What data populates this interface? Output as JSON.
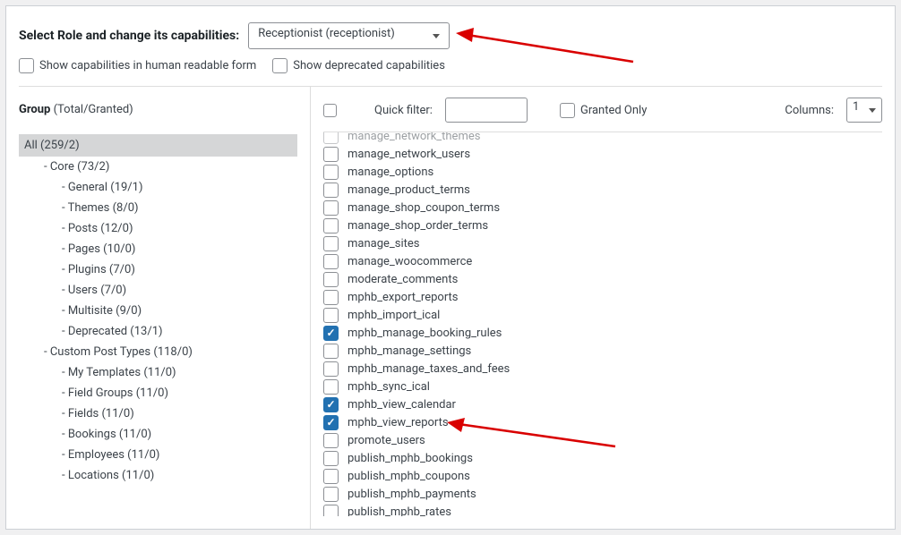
{
  "header": {
    "label": "Select Role and change its capabilities:",
    "selected_role": "Receptionist (receptionist)"
  },
  "options": {
    "human_readable_label": "Show capabilities in human readable form",
    "deprecated_label": "Show deprecated capabilities"
  },
  "sidebar": {
    "title_strong": "Group",
    "title_counts": "(Total/Granted)",
    "all_label": "All (259/2)",
    "tree": [
      {
        "lvl": 1,
        "label": "- Core (73/2)"
      },
      {
        "lvl": 2,
        "label": "- General (19/1)"
      },
      {
        "lvl": 2,
        "label": "- Themes (8/0)"
      },
      {
        "lvl": 2,
        "label": "- Posts (12/0)"
      },
      {
        "lvl": 2,
        "label": "- Pages (10/0)"
      },
      {
        "lvl": 2,
        "label": "- Plugins (7/0)"
      },
      {
        "lvl": 2,
        "label": "- Users (7/0)"
      },
      {
        "lvl": 2,
        "label": "- Multisite (9/0)"
      },
      {
        "lvl": 2,
        "label": "- Deprecated (13/1)"
      },
      {
        "lvl": 1,
        "label": "- Custom Post Types (118/0)"
      },
      {
        "lvl": 2,
        "label": "- My Templates (11/0)"
      },
      {
        "lvl": 2,
        "label": "- Field Groups (11/0)"
      },
      {
        "lvl": 2,
        "label": "- Fields (11/0)"
      },
      {
        "lvl": 2,
        "label": "- Bookings (11/0)"
      },
      {
        "lvl": 2,
        "label": "- Employees (11/0)"
      },
      {
        "lvl": 2,
        "label": "- Locations (11/0)"
      }
    ]
  },
  "toolbar": {
    "quick_filter_label": "Quick filter:",
    "granted_only_label": "Granted Only",
    "columns_label": "Columns:",
    "columns_value": "1"
  },
  "capabilities": [
    {
      "name": "manage_network_themes",
      "checked": false,
      "dim": true
    },
    {
      "name": "manage_network_users",
      "checked": false
    },
    {
      "name": "manage_options",
      "checked": false
    },
    {
      "name": "manage_product_terms",
      "checked": false
    },
    {
      "name": "manage_shop_coupon_terms",
      "checked": false
    },
    {
      "name": "manage_shop_order_terms",
      "checked": false
    },
    {
      "name": "manage_sites",
      "checked": false
    },
    {
      "name": "manage_woocommerce",
      "checked": false
    },
    {
      "name": "moderate_comments",
      "checked": false
    },
    {
      "name": "mphb_export_reports",
      "checked": false
    },
    {
      "name": "mphb_import_ical",
      "checked": false
    },
    {
      "name": "mphb_manage_booking_rules",
      "checked": true
    },
    {
      "name": "mphb_manage_settings",
      "checked": false
    },
    {
      "name": "mphb_manage_taxes_and_fees",
      "checked": false
    },
    {
      "name": "mphb_sync_ical",
      "checked": false
    },
    {
      "name": "mphb_view_calendar",
      "checked": true
    },
    {
      "name": "mphb_view_reports",
      "checked": true
    },
    {
      "name": "promote_users",
      "checked": false
    },
    {
      "name": "publish_mphb_bookings",
      "checked": false
    },
    {
      "name": "publish_mphb_coupons",
      "checked": false
    },
    {
      "name": "publish_mphb_payments",
      "checked": false
    },
    {
      "name": "publish_mphb_rates",
      "checked": false
    }
  ]
}
